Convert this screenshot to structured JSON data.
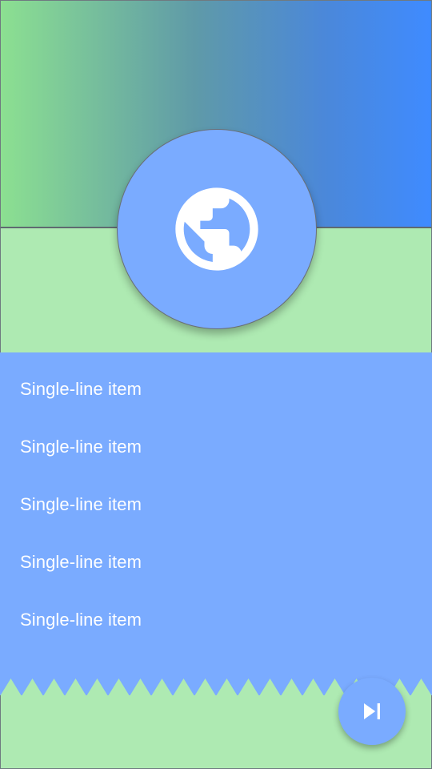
{
  "header": {
    "avatar_icon": "globe-icon"
  },
  "list": {
    "items": [
      {
        "label": "Single-line item"
      },
      {
        "label": "Single-line item"
      },
      {
        "label": "Single-line item"
      },
      {
        "label": "Single-line item"
      },
      {
        "label": "Single-line item"
      }
    ]
  },
  "fab": {
    "icon": "skip-next-icon"
  },
  "colors": {
    "gradient_start": "#8ce091",
    "gradient_end": "#3f8bff",
    "accent_blue": "#7aabff",
    "background_green": "#aeeab2",
    "text": "#ffffff"
  }
}
